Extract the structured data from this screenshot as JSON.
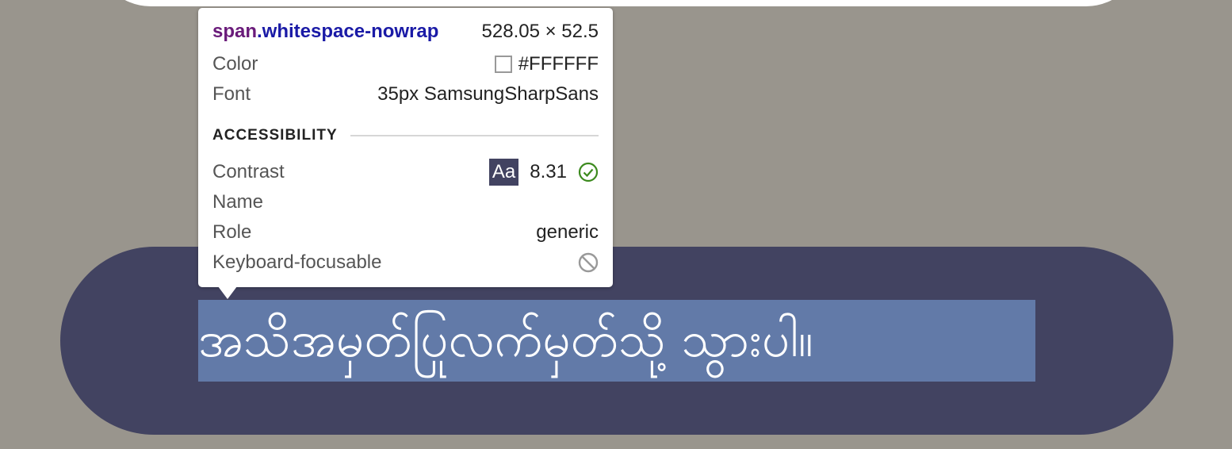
{
  "page": {
    "button_text": "အသိအမှတ်ပြုလက်မှတ်သို့ သွားပါ။"
  },
  "inspector": {
    "tag": "span",
    "class_name": ".whitespace-nowrap",
    "dimensions": "528.05 × 52.5",
    "color_label": "Color",
    "color_value": "#FFFFFF",
    "font_label": "Font",
    "font_value": "35px SamsungSharpSans",
    "section_title": "ACCESSIBILITY",
    "contrast_label": "Contrast",
    "contrast_sample": "Aa",
    "contrast_value": "8.31",
    "name_label": "Name",
    "role_label": "Role",
    "role_value": "generic",
    "focusable_label": "Keyboard-focusable"
  },
  "colors": {
    "background": "#99958d",
    "button": "#424361",
    "pass": "#3c8a1e"
  }
}
